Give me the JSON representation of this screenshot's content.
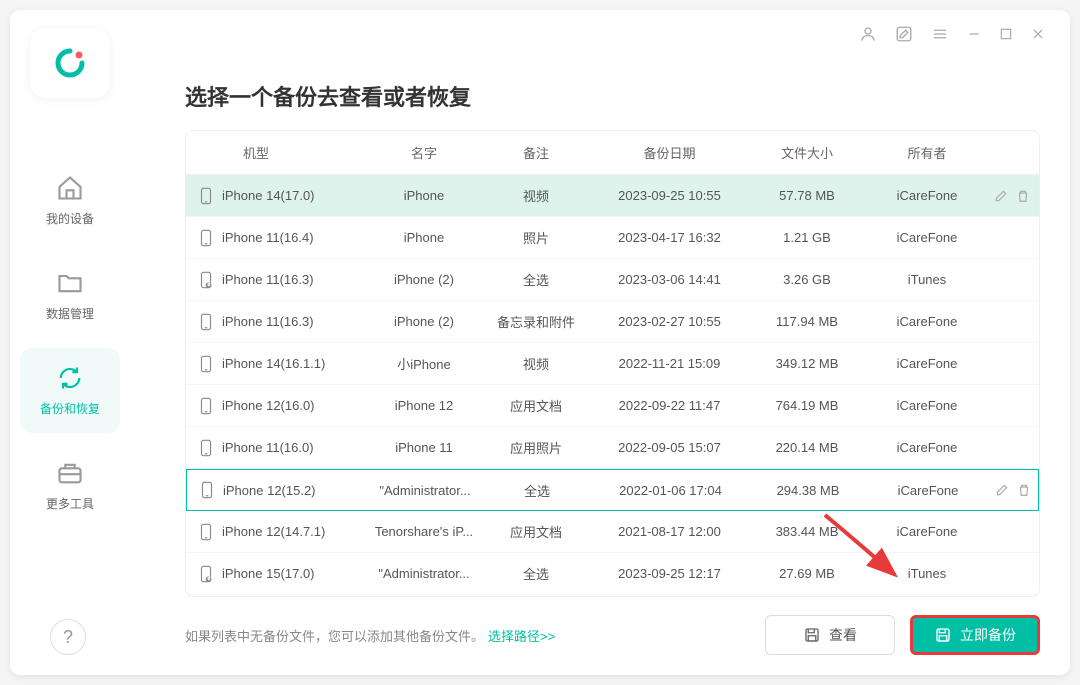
{
  "sidebar": {
    "items": [
      {
        "label": "我的设备"
      },
      {
        "label": "数据管理"
      },
      {
        "label": "备份和恢复"
      },
      {
        "label": "更多工具"
      }
    ]
  },
  "main": {
    "title": "选择一个备份去查看或者恢复",
    "columns": {
      "model": "机型",
      "name": "名字",
      "note": "备注",
      "date": "备份日期",
      "size": "文件大小",
      "owner": "所有者"
    },
    "rows": [
      {
        "model": "iPhone 14(17.0)",
        "name": "iPhone",
        "note": "视频",
        "date": "2023-09-25 10:55",
        "size": "57.78 MB",
        "owner": "iCareFone",
        "highlighted": true,
        "showActions": true,
        "itunes": false
      },
      {
        "model": "iPhone 11(16.4)",
        "name": "iPhone",
        "note": "照片",
        "date": "2023-04-17 16:32",
        "size": "1.21 GB",
        "owner": "iCareFone",
        "itunes": false
      },
      {
        "model": "iPhone 11(16.3)",
        "name": "iPhone (2)",
        "note": "全选",
        "date": "2023-03-06 14:41",
        "size": "3.26 GB",
        "owner": "iTunes",
        "itunes": true
      },
      {
        "model": "iPhone 11(16.3)",
        "name": "iPhone (2)",
        "note": "备忘录和附件",
        "date": "2023-02-27 10:55",
        "size": "117.94 MB",
        "owner": "iCareFone",
        "itunes": false
      },
      {
        "model": "iPhone 14(16.1.1)",
        "name": "小iPhone",
        "note": "视频",
        "date": "2022-11-21 15:09",
        "size": "349.12 MB",
        "owner": "iCareFone",
        "itunes": false
      },
      {
        "model": "iPhone 12(16.0)",
        "name": "iPhone 12",
        "note": "应用文档",
        "date": "2022-09-22 11:47",
        "size": "764.19 MB",
        "owner": "iCareFone",
        "itunes": false
      },
      {
        "model": "iPhone 11(16.0)",
        "name": "iPhone 11",
        "note": "应用照片",
        "date": "2022-09-05 15:07",
        "size": "220.14 MB",
        "owner": "iCareFone",
        "itunes": false
      },
      {
        "model": "iPhone 12(15.2)",
        "name": "\"Administrator...",
        "note": "全选",
        "date": "2022-01-06 17:04",
        "size": "294.38 MB",
        "owner": "iCareFone",
        "outlined": true,
        "showActions": true,
        "itunes": false
      },
      {
        "model": "iPhone 12(14.7.1)",
        "name": "Tenorshare's iP...",
        "note": "应用文档",
        "date": "2021-08-17 12:00",
        "size": "383.44 MB",
        "owner": "iCareFone",
        "itunes": false
      },
      {
        "model": "iPhone 15(17.0)",
        "name": "\"Administrator...",
        "note": "全选",
        "date": "2023-09-25 12:17",
        "size": "27.69 MB",
        "owner": "iTunes",
        "itunes": true
      }
    ],
    "footer": {
      "text": "如果列表中无备份文件，您可以添加其他备份文件。",
      "link": "选择路径>>",
      "viewBtn": "查看",
      "backupBtn": "立即备份"
    }
  }
}
